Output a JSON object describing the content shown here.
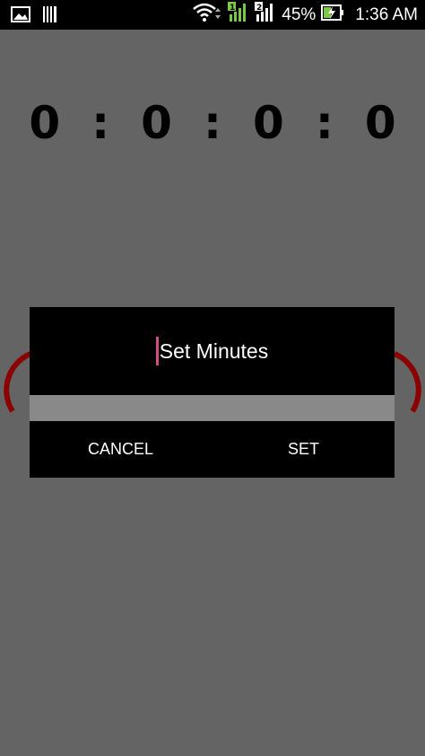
{
  "status_bar": {
    "left_icons": [
      "image-icon",
      "barcode-icon"
    ],
    "right_icons": [
      "wifi-icon",
      "signal-sim1-icon",
      "signal-sim2-icon",
      "battery-charging-icon"
    ],
    "battery": "45%",
    "time": "1:36 AM"
  },
  "timer": {
    "d1": "0",
    "d2": "0",
    "d3": "0",
    "d4": "0",
    "separator": ":"
  },
  "dialog": {
    "input_placeholder": "Set Minutes",
    "cancel_label": "CANCEL",
    "set_label": "SET"
  },
  "colors": {
    "background": "#646464",
    "dialog": "#000000",
    "caret": "#d44b87",
    "ring": "#8b0000",
    "divider": "#898989"
  }
}
